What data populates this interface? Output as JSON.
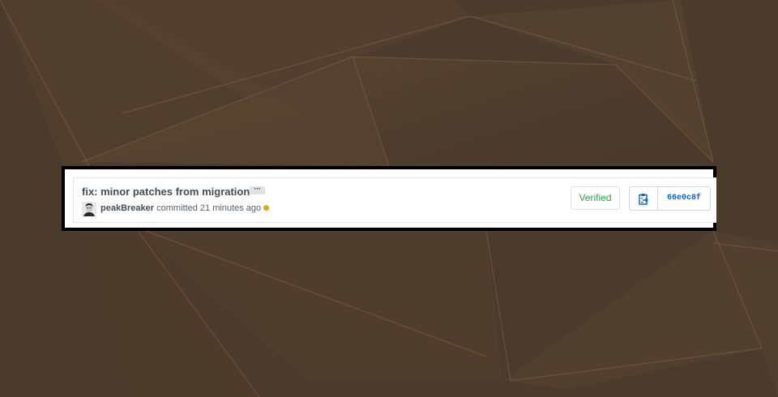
{
  "commit": {
    "title": "fix: minor patches from migration",
    "ellipsis_label": "···",
    "author": "peakBreaker",
    "action": " committed 21 minutes ago",
    "status_color": "#dbab09",
    "verified_label": "Verified",
    "sha": "66e0c8f"
  },
  "colors": {
    "background": "#4d3c2e",
    "verified": "#28a745",
    "link": "#0366d6"
  },
  "icons": {
    "copy": "clipboard-icon",
    "more": "ellipsis-icon"
  }
}
